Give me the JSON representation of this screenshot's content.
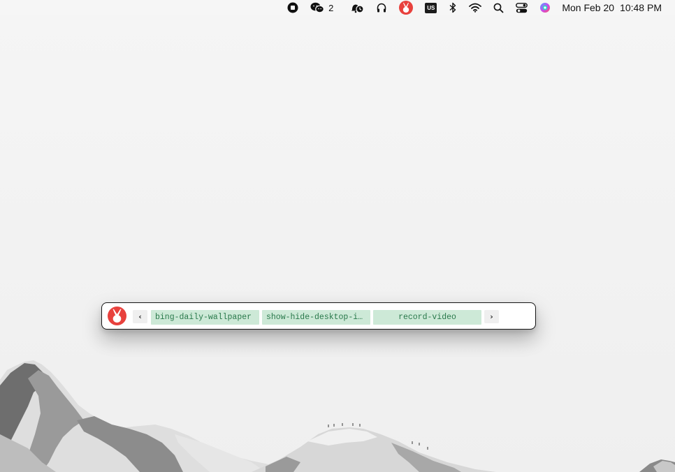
{
  "menubar": {
    "icons": [
      "stop-recording-icon",
      "wechat-icon",
      "bell-clock-icon",
      "headphones-icon",
      "raycast-app-icon",
      "input-source-icon",
      "bluetooth-icon",
      "wifi-icon",
      "search-icon",
      "control-center-icon",
      "siri-icon"
    ],
    "wechat_count": "2",
    "input_source": "US",
    "date": "Mon Feb 20",
    "time": "10:48 PM"
  },
  "launcher": {
    "app_icon": "rabbit-logo-icon",
    "prev_label": "‹",
    "next_label": "›",
    "tabs": [
      {
        "label": "bing-daily-wallpaper",
        "active": false
      },
      {
        "label": "show-hide-desktop-icons",
        "active": false
      },
      {
        "label": "record-video",
        "active": true
      }
    ]
  },
  "colors": {
    "tab_bg": "#cde9d7",
    "tab_text": "#28784a",
    "logo_red": "#e8413d",
    "menubar_bg": "#f6f6f6"
  }
}
